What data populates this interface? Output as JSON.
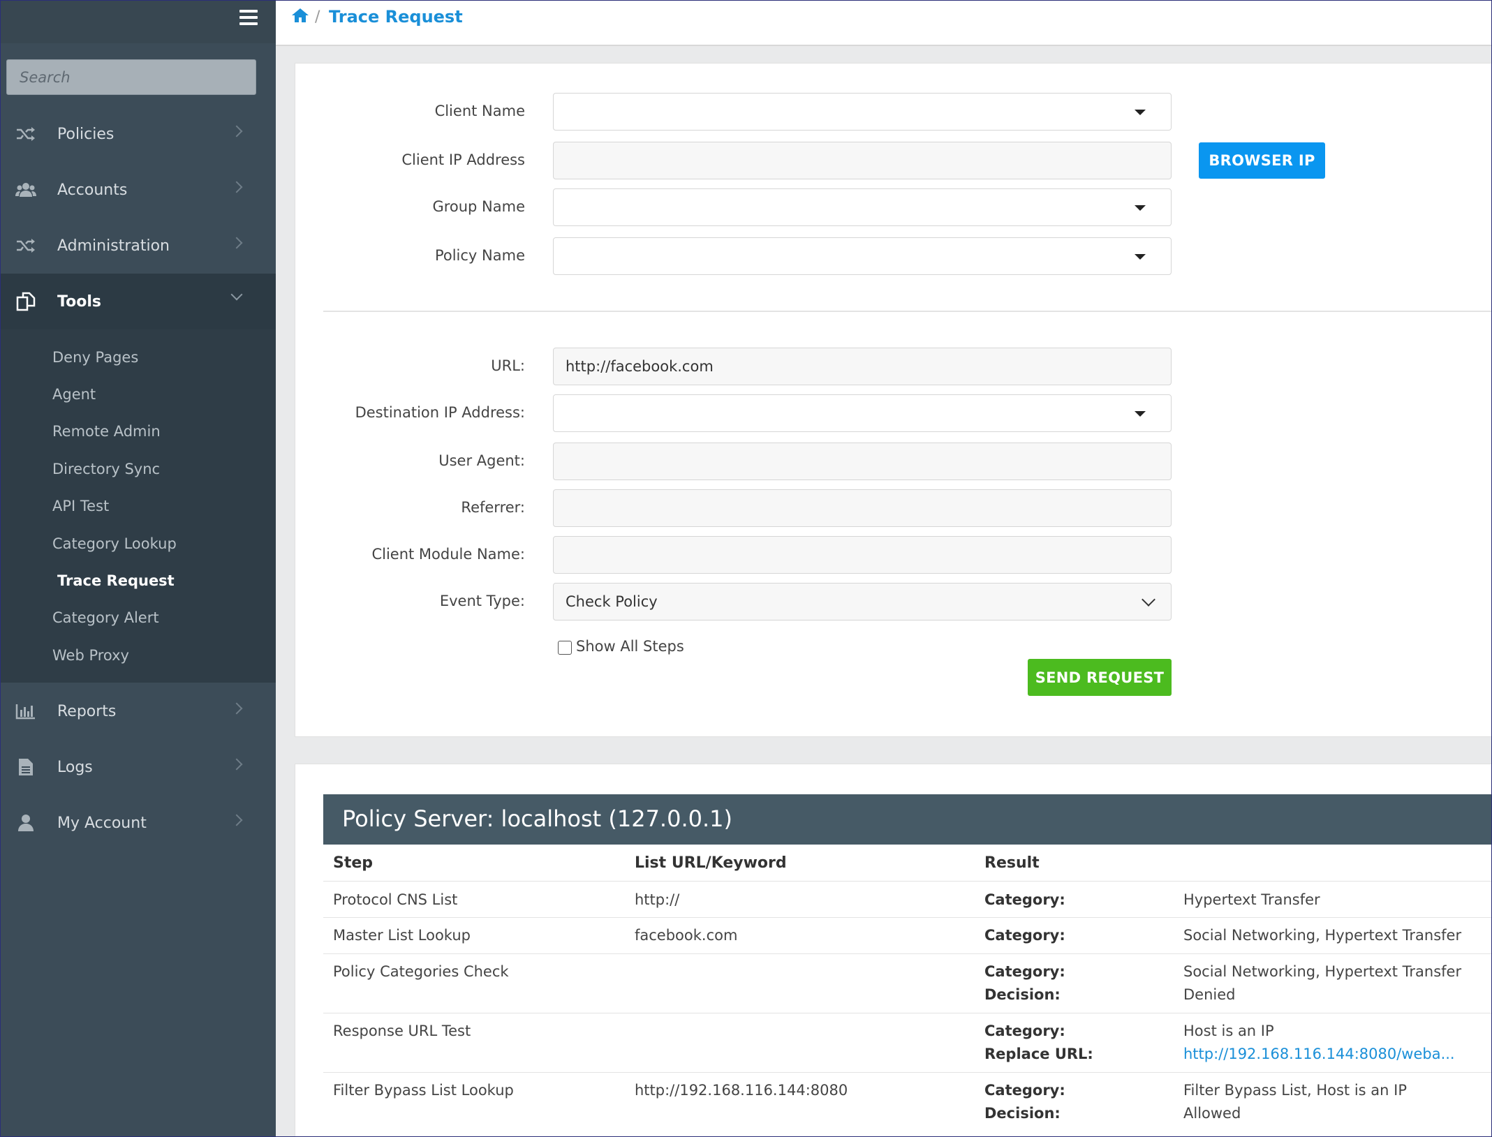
{
  "sidebar": {
    "search_placeholder": "Search",
    "nav": [
      {
        "label": "Policies",
        "icon": "shuffle-icon"
      },
      {
        "label": "Accounts",
        "icon": "users-icon"
      },
      {
        "label": "Administration",
        "icon": "shuffle-icon"
      },
      {
        "label": "Tools",
        "icon": "copy-icon"
      },
      {
        "label": "Reports",
        "icon": "bar-chart-icon"
      },
      {
        "label": "Logs",
        "icon": "file-icon"
      },
      {
        "label": "My Account",
        "icon": "user-icon"
      }
    ],
    "tools_submenu": [
      "Deny Pages",
      "Agent",
      "Remote Admin",
      "Directory Sync",
      "API Test",
      "Category Lookup",
      "Trace Request",
      "Category Alert",
      "Web Proxy"
    ],
    "current_submenu": "Trace Request"
  },
  "breadcrumb": {
    "current": "Trace Request",
    "separator": "/"
  },
  "form": {
    "client_name_label": "Client Name",
    "client_ip_label": "Client IP Address",
    "group_name_label": "Group Name",
    "policy_name_label": "Policy Name",
    "browser_ip_button": "BROWSER IP",
    "url_label": "URL:",
    "url_value": "http://facebook.com",
    "dest_ip_label": "Destination IP Address:",
    "user_agent_label": "User Agent:",
    "referrer_label": "Referrer:",
    "client_module_label": "Client Module Name:",
    "event_type_label": "Event Type:",
    "event_type_value": "Check Policy",
    "show_all_steps_label": "Show All Steps",
    "send_button": "SEND REQUEST"
  },
  "results": {
    "title": "Policy Server: localhost (127.0.0.1)",
    "headers": [
      "Step",
      "List URL/Keyword",
      "Result"
    ],
    "rows": [
      {
        "step": "Protocol CNS List",
        "list": "http://",
        "keys": [
          "Category:"
        ],
        "values": [
          "Hypertext Transfer"
        ]
      },
      {
        "step": "Master List Lookup",
        "list": "facebook.com",
        "keys": [
          "Category:"
        ],
        "values": [
          "Social Networking, Hypertext Transfer"
        ]
      },
      {
        "step": "Policy Categories Check",
        "list": "",
        "keys": [
          "Category:",
          "Decision:"
        ],
        "values": [
          "Social Networking, Hypertext Transfer",
          "Denied"
        ]
      },
      {
        "step": "Response URL Test",
        "list": "",
        "keys": [
          "Category:",
          "Replace URL:"
        ],
        "values": [
          "Host is an IP",
          "http://192.168.116.144:8080/weba..."
        ]
      },
      {
        "step": "Filter Bypass List Lookup",
        "list": "http://192.168.116.144:8080",
        "keys": [
          "Category:",
          "Decision:"
        ],
        "values": [
          "Filter Bypass List, Host is an IP",
          "Allowed"
        ]
      }
    ]
  },
  "colors": {
    "accent": "#0a96f0",
    "send": "#4cbb1f",
    "sidebar": "#3c4c58",
    "header": "#465a66"
  }
}
